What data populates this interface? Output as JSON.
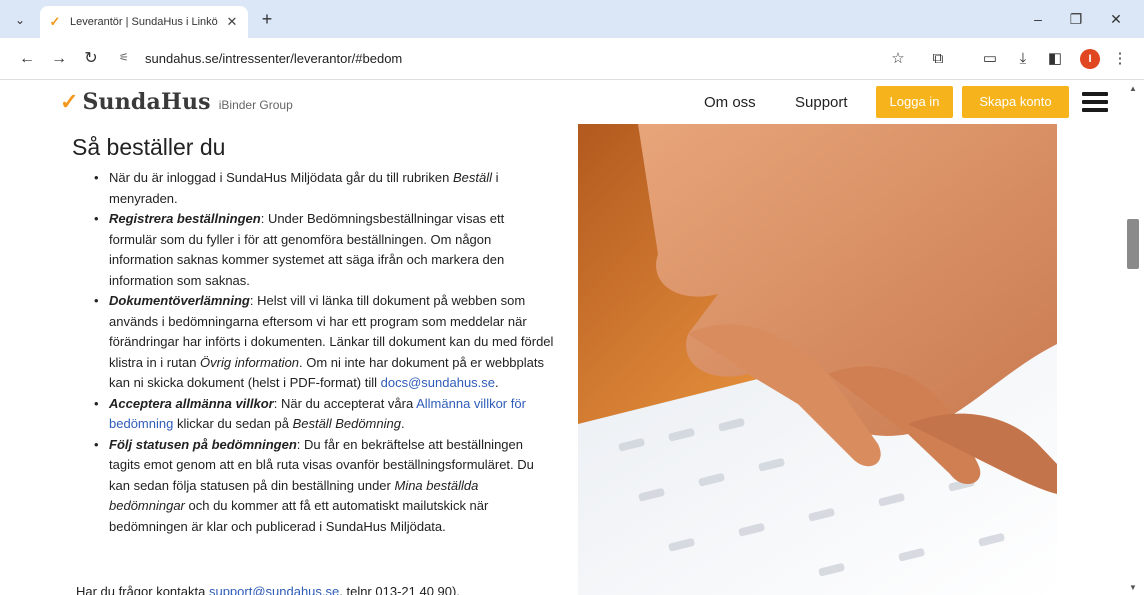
{
  "browser": {
    "tab_title": "Leverantör | SundaHus i Linkö",
    "url": "sundahus.se/intressenter/leverantor/#bedom"
  },
  "site": {
    "logo_text": "SundaHus",
    "logo_sub": "iBinder Group",
    "nav": {
      "about": "Om oss",
      "support": "Support",
      "login": "Logga in",
      "signup": "Skapa konto"
    },
    "colors": {
      "accent": "#f6b31b",
      "link": "#2f5db8"
    }
  },
  "content": {
    "heading": "Så beställer du",
    "items": [
      {
        "a": "När du är inloggad i SundaHus Miljödata går du till rubriken ",
        "a_italic": "Beställ",
        "b": " i menyraden."
      },
      {
        "bold": "Registrera beställningen",
        "text": ": Under Bedömningsbeställningar visas ett formulär som du fyller i för att genomföra beställningen. Om någon information saknas kommer systemet att säga ifrån och markera den information som saknas."
      },
      {
        "bold": "Dokumentöverlämning",
        "text1": ": Helst vill vi länka till dokument på webben som används i bedömningarna eftersom vi har ett program som meddelar när förändringar har införts i dokumenten. Länkar till dokument kan du med fördel klistra in i rutan ",
        "italic": "Övrig information",
        "text2": ". Om ni inte har dokument på er webbplats kan ni skicka dokument (helst i PDF-format) till ",
        "link": "docs@sundahus.se",
        "text3": "."
      },
      {
        "bold": "Acceptera allmänna villkor",
        "text1": ": När du accepterat våra ",
        "link": "Allmänna villkor för bedömning",
        "text2": " klickar du sedan på ",
        "italic": "Beställ Bedömning",
        "text3": "."
      },
      {
        "bold": "Följ statusen på bedömningen",
        "text1": ": Du får en bekräftelse att beställningen tagits emot genom att en blå ruta visas ovanför beställningsformuläret. Du kan sedan följa statusen på din beställning under ",
        "italic": "Mina beställda bedömningar",
        "text2": " och du kommer att få ett automatiskt mailutskick när bedömningen är klar och publicerad i SundaHus Miljödata."
      }
    ],
    "contact": {
      "prefix": "Har du frågor kontakta ",
      "email": "support@sundahus.se",
      "suffix": ", telnr 013-21 40 90)."
    }
  },
  "icons": {
    "tab_list": "chevron-down-icon",
    "favicon": "sundahus-favicon",
    "close": "close-icon",
    "new_tab": "plus-icon",
    "back": "back-arrow-icon",
    "forward": "forward-arrow-icon",
    "reload": "reload-icon",
    "site_info": "site-info-icon",
    "bookmark": "star-icon",
    "extensions": "puzzle-icon",
    "cast": "cast-icon",
    "download": "download-icon",
    "side_panel": "side-panel-icon",
    "menu": "kebab-menu-icon"
  }
}
